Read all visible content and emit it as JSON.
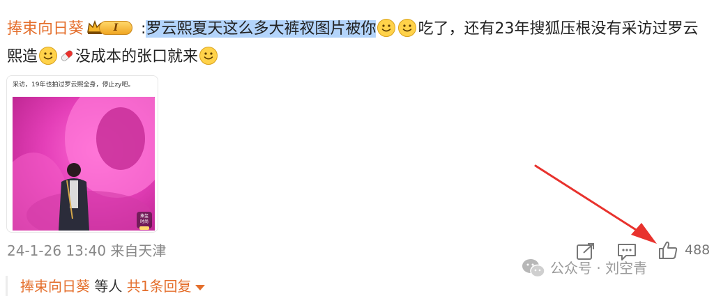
{
  "comment": {
    "username": "捧束向日葵",
    "badge_level": "I",
    "separator": ":",
    "highlighted_text": "罗云熙夏天这么多大裤衩图片被你",
    "text_part2": "吃了，还有23年搜狐压根没有采访过罗云熙造",
    "text_part3": "没成本的张口就来",
    "emoji_name": "smile-emoji",
    "pill_emoji_name": "pill-emoji"
  },
  "thumbnail": {
    "caption": "采访，19年也拍过罗云熙全身，停止zy吧。",
    "watermark_line1": "捧玺",
    "watermark_line2": "时尚"
  },
  "meta": {
    "timestamp": "24-1-26 13:40",
    "source": "来自天津"
  },
  "actions": {
    "share_icon": "share-icon",
    "comment_icon": "comment-icon",
    "like_icon": "thumbs-up-icon",
    "like_count": "488"
  },
  "watermark": {
    "text": "公众号 · 刘空青"
  },
  "reply_summary": {
    "user": "捧束向日葵",
    "others": " 等人 ",
    "more": "共1条回复"
  },
  "colors": {
    "username": "#e46e2b",
    "highlight": "#b3d4fb",
    "annotation_arrow": "#e8322d",
    "meta_text": "#888888"
  }
}
